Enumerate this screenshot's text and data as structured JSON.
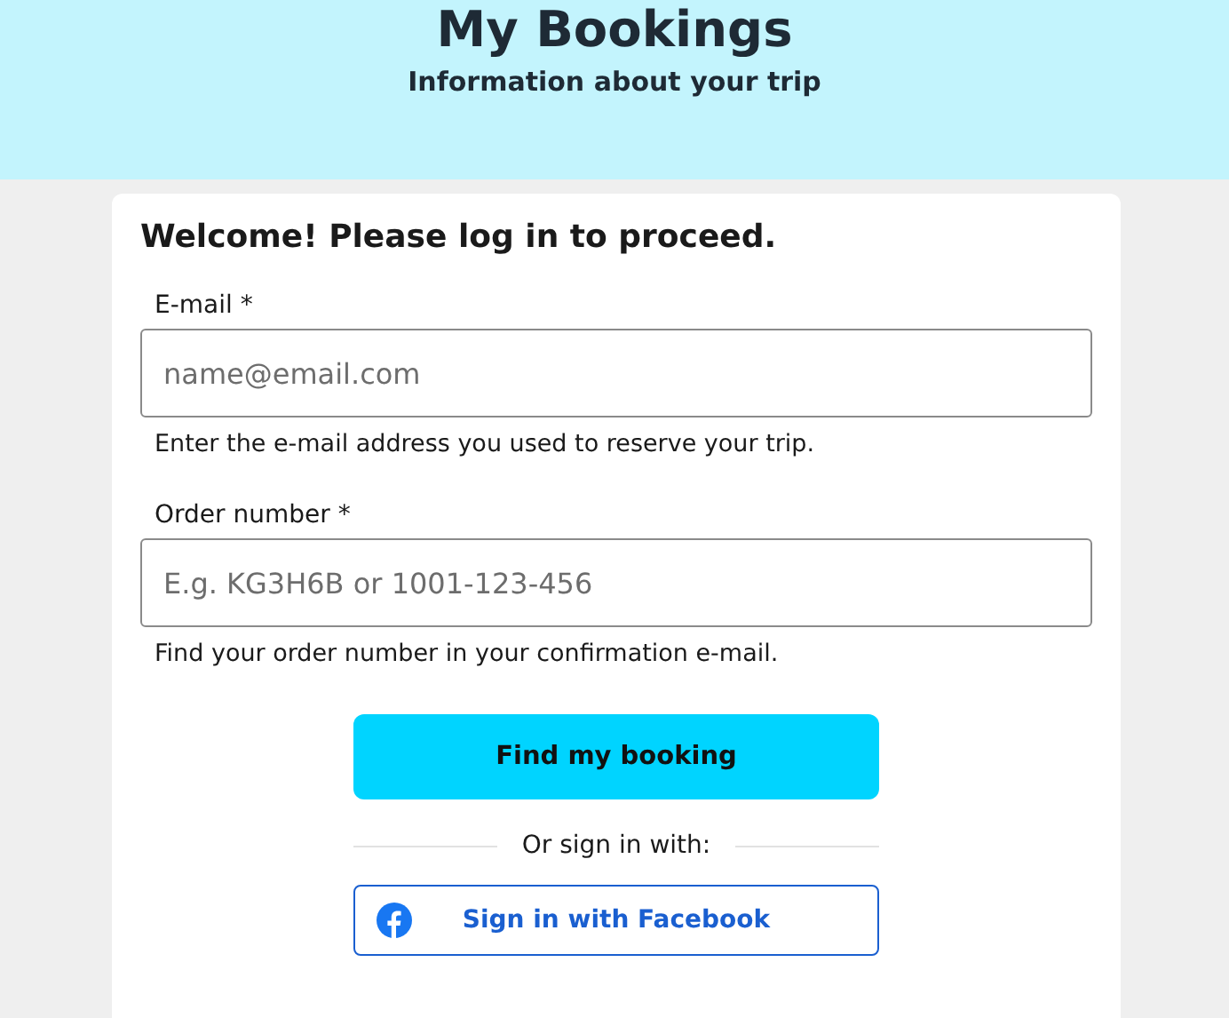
{
  "header": {
    "title": "My Bookings",
    "subtitle": "Information about your trip"
  },
  "form": {
    "heading": "Welcome! Please log in to proceed.",
    "fields": [
      {
        "label": "E-mail *",
        "placeholder": "name@email.com",
        "hint": "Enter the e-mail address you used to reserve your trip."
      },
      {
        "label": "Order number *",
        "placeholder": "E.g. KG3H6B or 1001-123-456",
        "hint": "Find your order number in your confirmation e-mail."
      }
    ],
    "submit": "Find my booking",
    "divider": "Or sign in with:",
    "social_buttons": [
      {
        "kind": "facebook",
        "label": "Sign in with Facebook"
      }
    ]
  }
}
